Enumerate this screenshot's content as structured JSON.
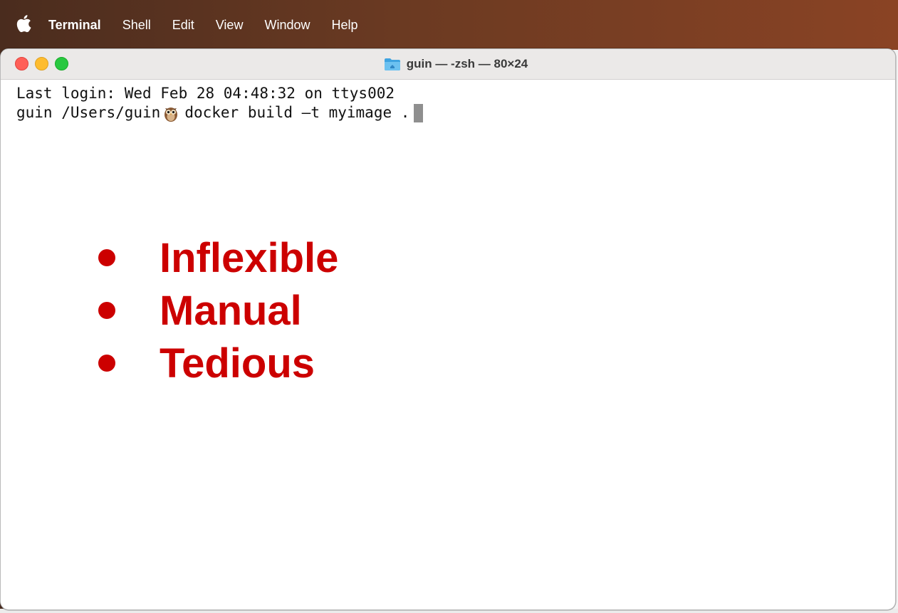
{
  "menubar": {
    "apple_icon": "apple-logo-icon",
    "app_name": "Terminal",
    "items": [
      "Shell",
      "Edit",
      "View",
      "Window",
      "Help"
    ]
  },
  "window": {
    "title": "guin — -zsh — 80×24",
    "title_icon": "home-folder-icon",
    "traffic_lights": {
      "close": "#ff5f57",
      "minimize": "#febc2e",
      "zoom": "#28c840"
    }
  },
  "terminal": {
    "line1": "Last login: Wed Feb 28 04:48:32 on ttys002",
    "prompt_user": "guin",
    "prompt_path": "/Users/guin",
    "prompt_icon": "owl-icon",
    "command": "docker build —t myimage ."
  },
  "overlay": {
    "color": "#cc0000",
    "bullets": [
      "Inflexible",
      "Manual",
      "Tedious"
    ]
  }
}
